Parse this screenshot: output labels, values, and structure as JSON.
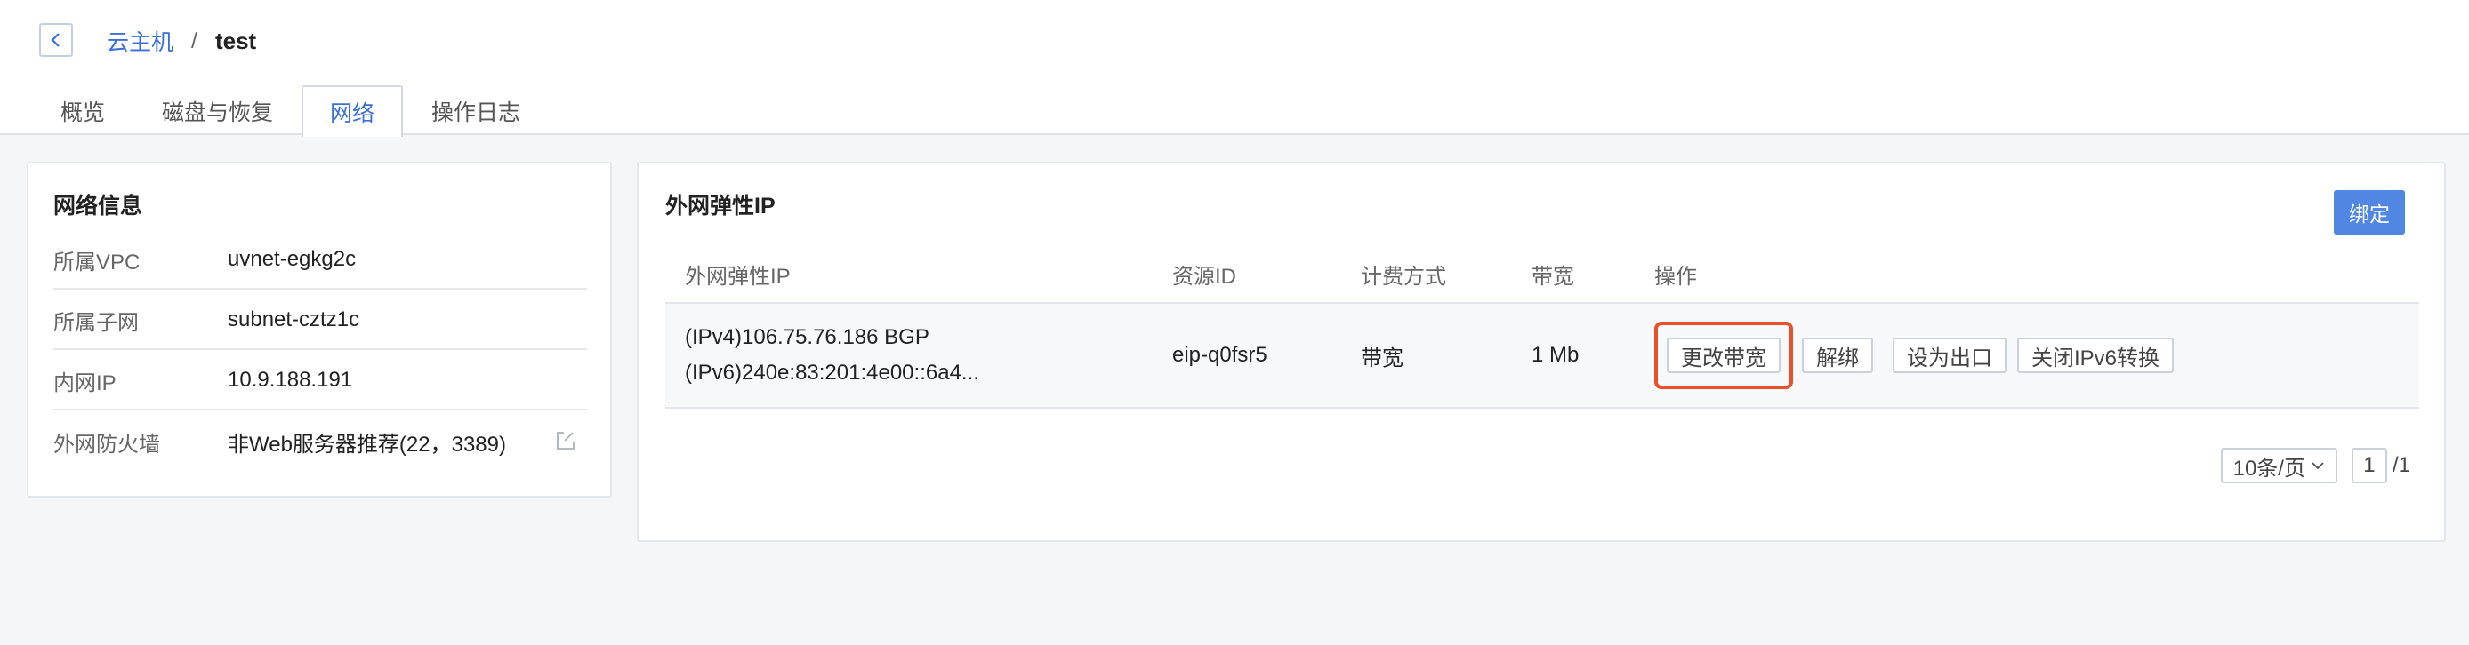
{
  "header": {
    "breadcrumb_parent": "云主机",
    "breadcrumb_sep": "/",
    "breadcrumb_current": "test"
  },
  "tabs": [
    {
      "label": "概览"
    },
    {
      "label": "磁盘与恢复"
    },
    {
      "label": "网络"
    },
    {
      "label": "操作日志"
    }
  ],
  "active_tab": "网络",
  "network_info": {
    "title": "网络信息",
    "rows": [
      {
        "label": "所属VPC",
        "value": "uvnet-egkg2c"
      },
      {
        "label": "所属子网",
        "value": "subnet-cztz1c"
      },
      {
        "label": "内网IP",
        "value": "10.9.188.191"
      },
      {
        "label": "外网防火墙",
        "value": "非Web服务器推荐(22，3389)"
      }
    ]
  },
  "eip_panel": {
    "title": "外网弹性IP",
    "bind_label": "绑定",
    "columns": [
      "外网弹性IP",
      "资源ID",
      "计费方式",
      "带宽",
      "操作"
    ],
    "rows": [
      {
        "ipv4": "(IPv4)106.75.76.186 BGP",
        "ipv6": "(IPv6)240e:83:201:4e00::6a4...",
        "resource_id": "eip-q0fsr5",
        "billing": "带宽",
        "bandwidth": "1 Mb",
        "actions": [
          "更改带宽",
          "解绑",
          "设为出口",
          "关闭IPv6转换"
        ]
      }
    ]
  },
  "pagination": {
    "page_size": "10条/页",
    "current_page": "1",
    "total": "/1"
  },
  "colors": {
    "accent": "#3a6fd8",
    "primary_button": "#4f87e3",
    "highlight_border": "#e8502a"
  }
}
